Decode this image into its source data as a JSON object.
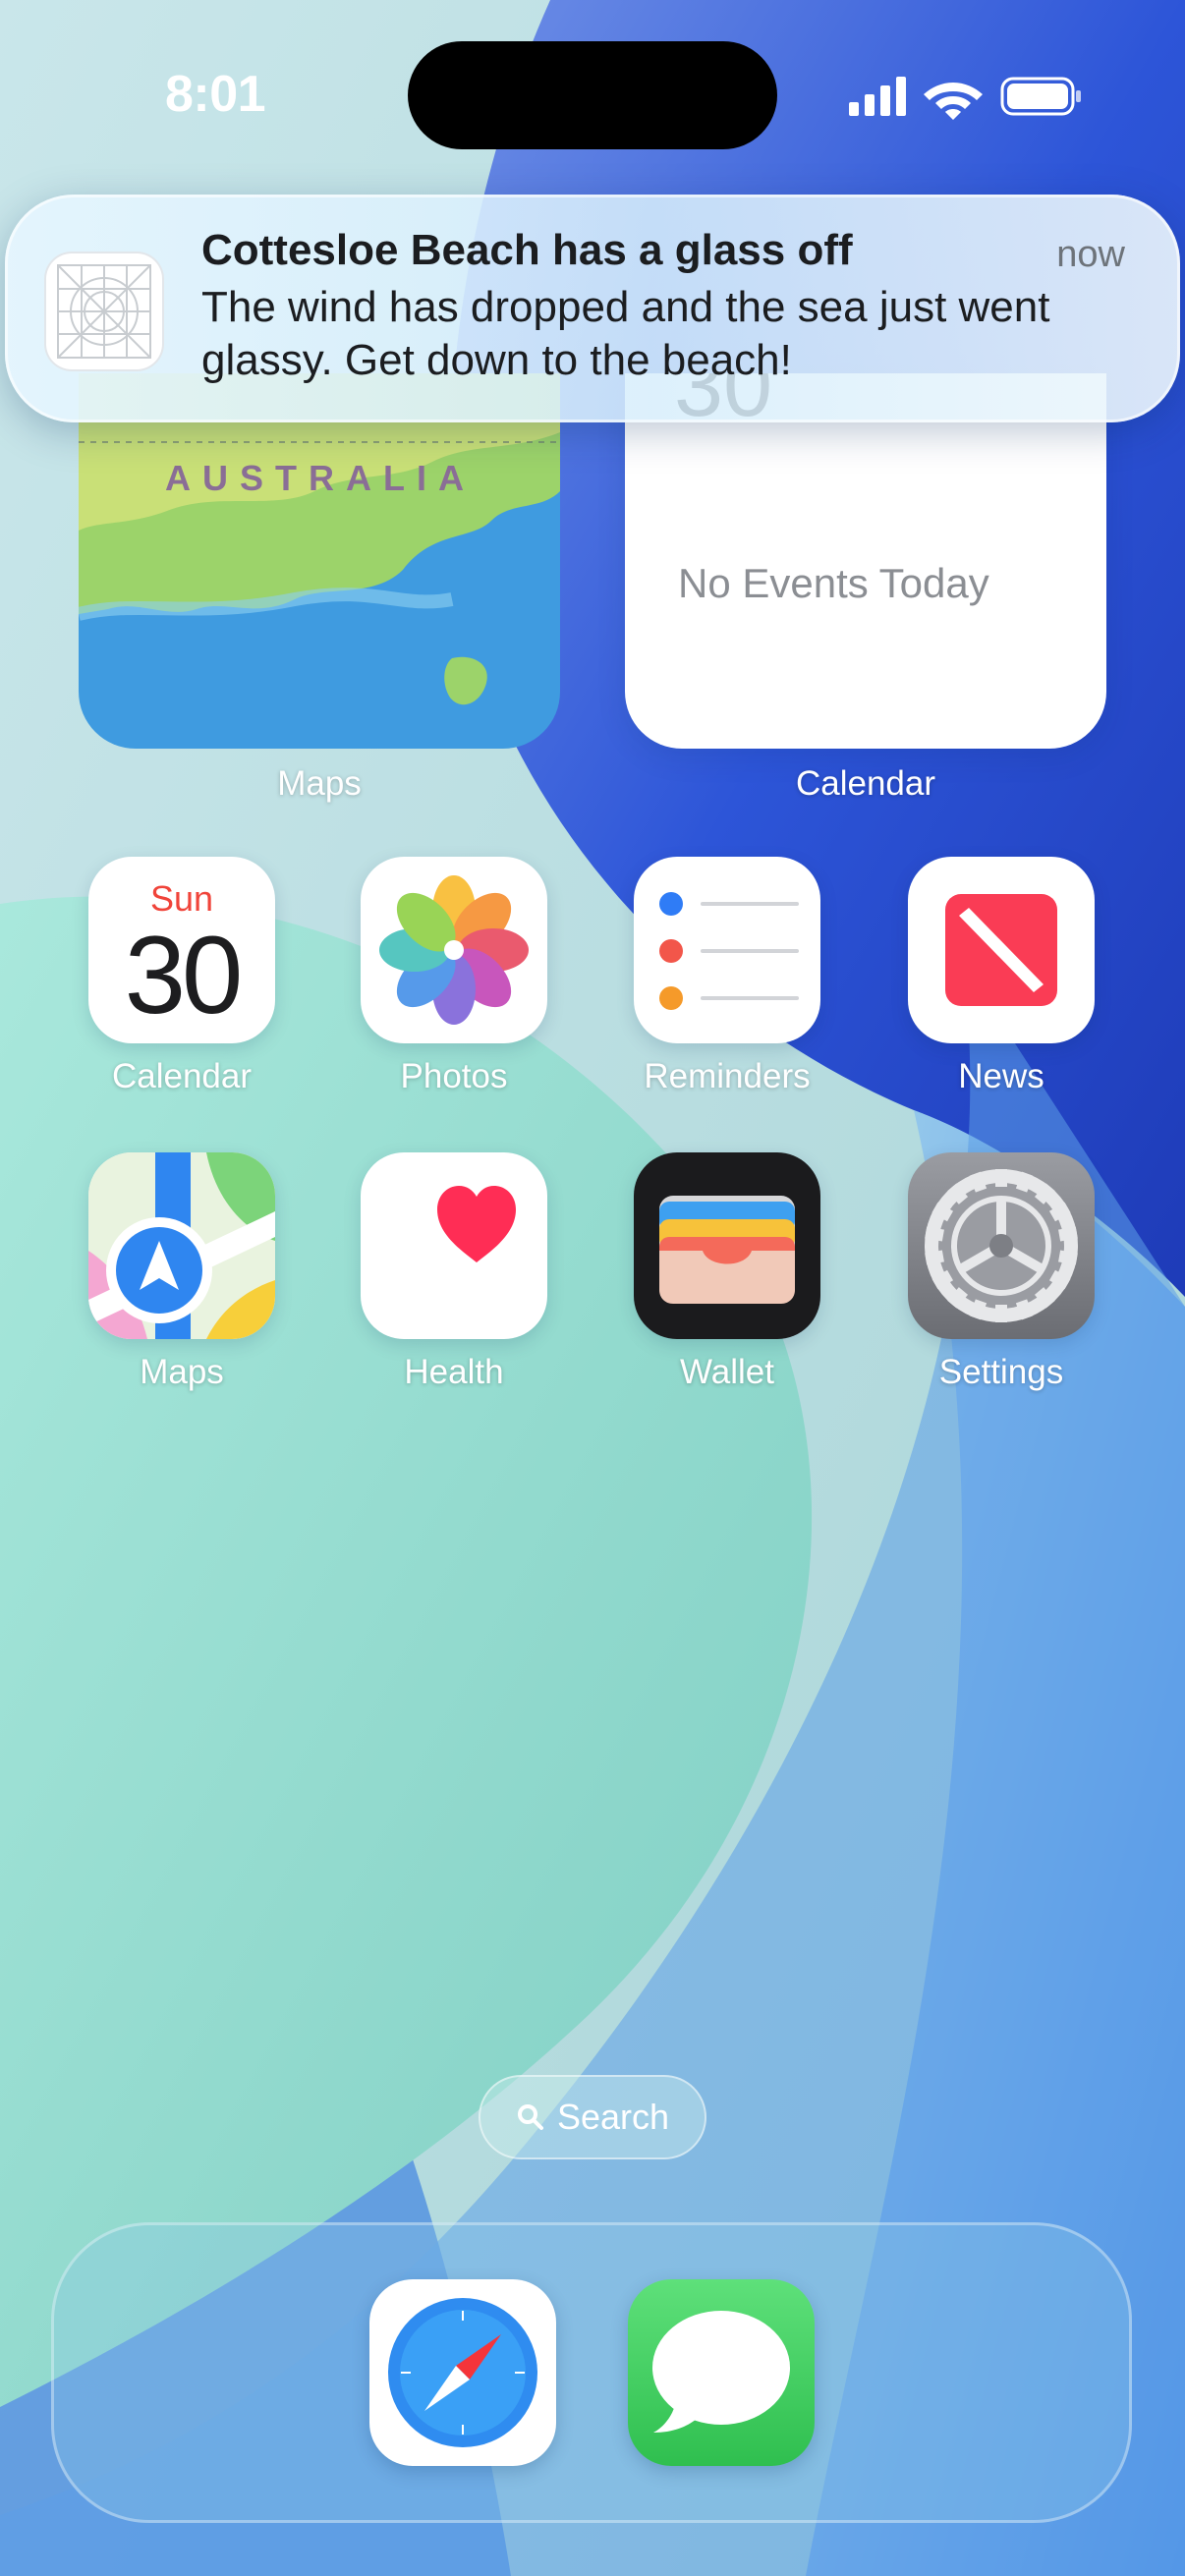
{
  "status_bar": {
    "time": "8:01"
  },
  "notification": {
    "title": "Cottesloe Beach has a glass off",
    "body": "The wind has dropped and the sea just went glassy. Get down to the beach!",
    "time": "now"
  },
  "widgets": {
    "maps": {
      "map_text": "AUSTRALIA",
      "label": "Maps"
    },
    "calendar": {
      "date_partial": "30",
      "no_events": "No Events Today",
      "label": "Calendar"
    }
  },
  "apps": [
    {
      "label": "Calendar",
      "day": "Sun",
      "date": "30"
    },
    {
      "label": "Photos"
    },
    {
      "label": "Reminders"
    },
    {
      "label": "News"
    },
    {
      "label": "Maps"
    },
    {
      "label": "Health"
    },
    {
      "label": "Wallet"
    },
    {
      "label": "Settings"
    }
  ],
  "search": {
    "label": "Search"
  },
  "dock": [
    {
      "name": "Safari"
    },
    {
      "name": "Messages"
    }
  ],
  "colors": {
    "wallpaper_teal": "#9fded2",
    "wallpaper_blue": "#2f5fe0",
    "calendar_red": "#f0443a",
    "news_red": "#fa3c55",
    "health_pink": "#ff2d55",
    "messages_green": "#34c759"
  }
}
